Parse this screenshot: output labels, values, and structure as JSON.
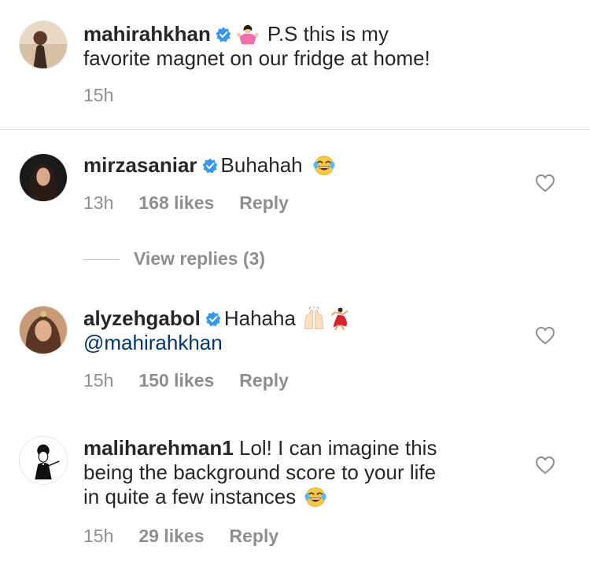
{
  "caption": {
    "username": "mahirahkhan",
    "text_line1": "P.S this is my",
    "text_line2": "favorite magnet on our fridge at home!",
    "time": "15h"
  },
  "comments": [
    {
      "username": "mirzasaniar",
      "text": "Buhahah",
      "time": "13h",
      "likes": "168 likes",
      "reply": "Reply"
    },
    {
      "username": "alyzehgabol",
      "text": "Hahaha",
      "mention": "@mahirahkhan",
      "time": "15h",
      "likes": "150 likes",
      "reply": "Reply"
    },
    {
      "username": "maliharehman1",
      "text_line1": "Lol! I can imagine this",
      "text_line2": "being the background score to your life",
      "text_line3": "in quite a few instances",
      "time": "15h",
      "likes": "29 likes",
      "reply": "Reply"
    }
  ],
  "view_replies": "View replies (3)",
  "colors": {
    "verified": "#3897f0",
    "mention": "#003569",
    "meta": "#8e8e8e"
  },
  "icons": [
    "verified-badge-icon",
    "shrug-emoji-icon",
    "laughing-emoji-icon",
    "raised-hands-emoji-icon",
    "dancer-emoji-icon",
    "heart-icon"
  ]
}
